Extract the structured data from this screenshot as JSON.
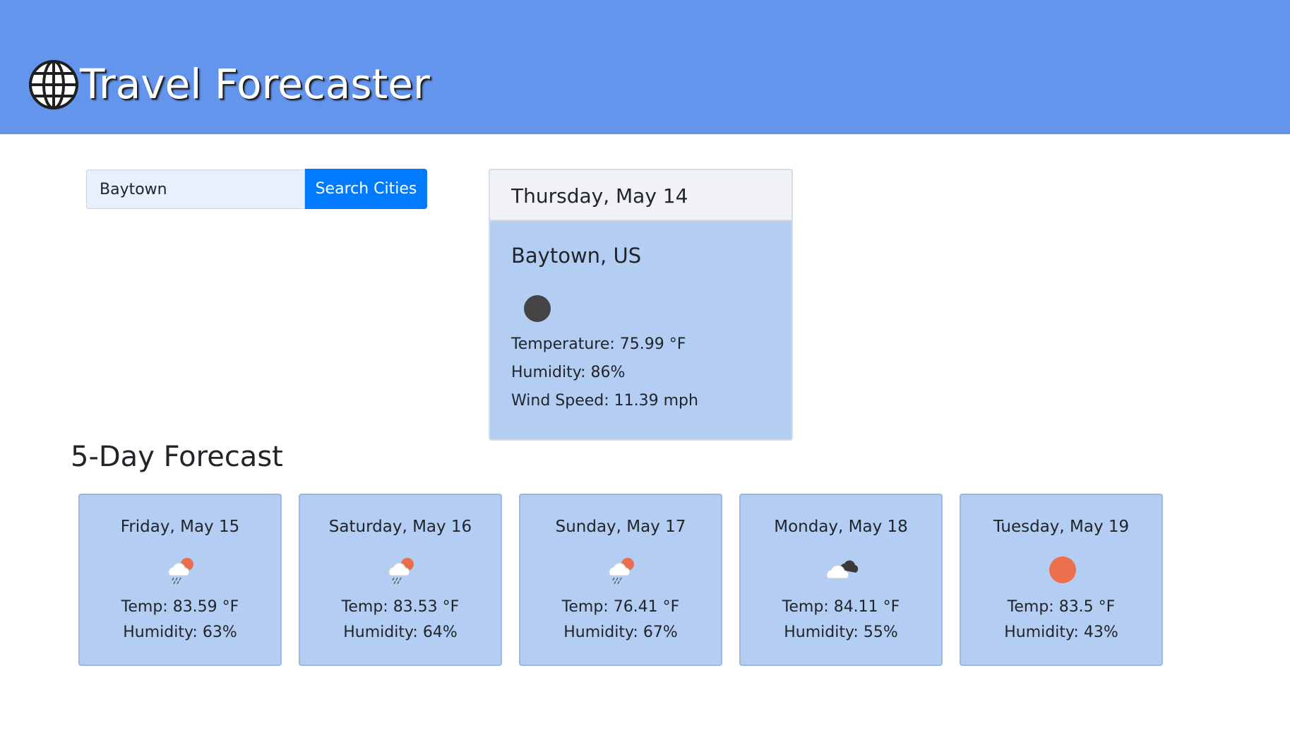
{
  "header": {
    "title": "Travel Forecaster",
    "logo_icon": "globe-icon",
    "background": "#6495ed"
  },
  "search": {
    "value": "Baytown",
    "button_label": "Search Cities",
    "button_color": "#007bff"
  },
  "current": {
    "date": "Thursday, May 14",
    "city": "Baytown, US",
    "icon": "night-clear-icon",
    "temperature": "Temperature: 75.99 °F",
    "humidity": "Humidity: 86%",
    "wind": "Wind Speed: 11.39 mph"
  },
  "forecast": {
    "title": "5-Day Forecast",
    "days": [
      {
        "date": "Friday, May 15",
        "icon": "rain-sun-icon",
        "temp": "Temp: 83.59 °F",
        "humidity": "Humidity: 63%"
      },
      {
        "date": "Saturday, May 16",
        "icon": "rain-sun-icon",
        "temp": "Temp: 83.53 °F",
        "humidity": "Humidity: 64%"
      },
      {
        "date": "Sunday, May 17",
        "icon": "rain-sun-icon",
        "temp": "Temp: 76.41 °F",
        "humidity": "Humidity: 67%"
      },
      {
        "date": "Monday, May 18",
        "icon": "broken-clouds-icon",
        "temp": "Temp: 84.11 °F",
        "humidity": "Humidity: 55%"
      },
      {
        "date": "Tuesday, May 19",
        "icon": "clear-sun-icon",
        "temp": "Temp: 83.5 °F",
        "humidity": "Humidity: 43%"
      }
    ]
  },
  "colors": {
    "card_bg": "#b3cef2",
    "sun": "#ec6e4c"
  }
}
